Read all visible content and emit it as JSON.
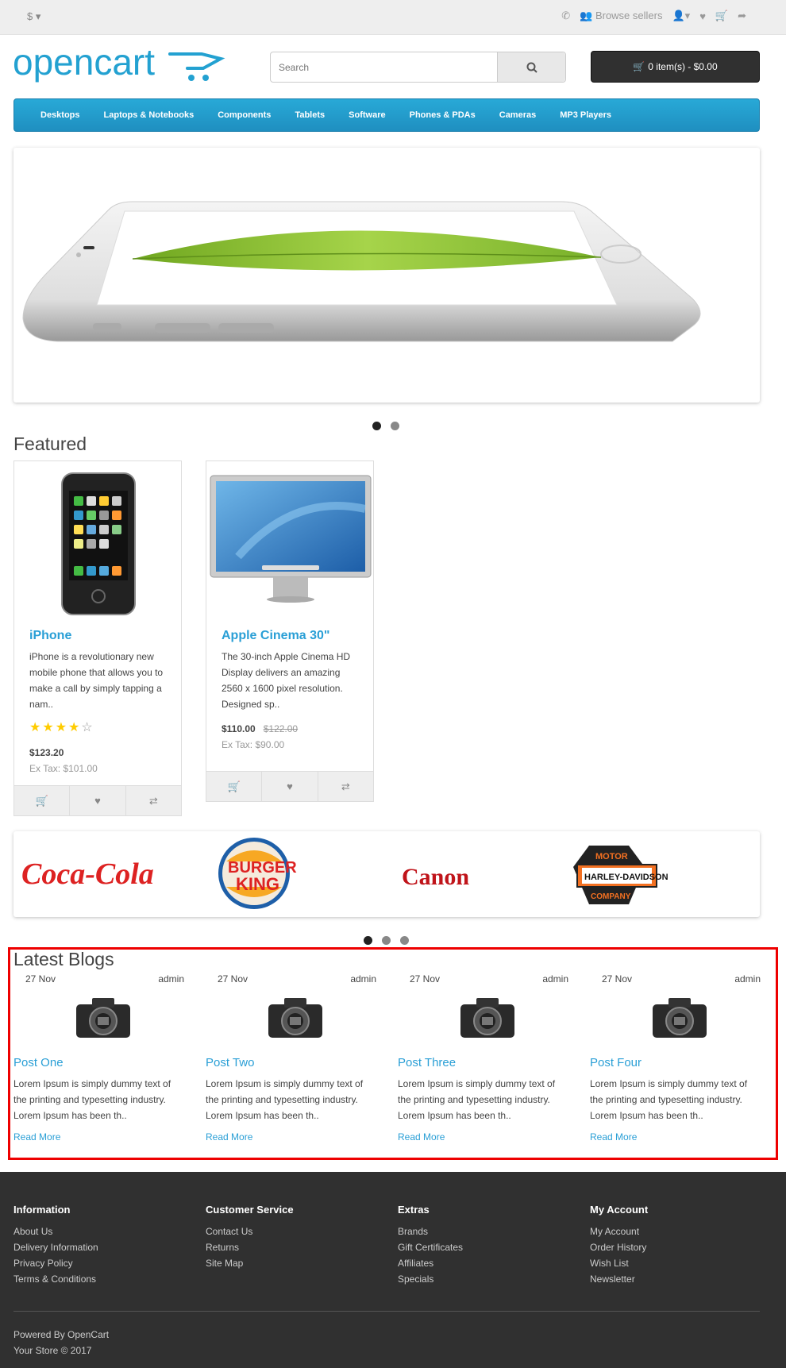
{
  "topbar": {
    "currency": "$",
    "browse_sellers": "Browse sellers"
  },
  "logo": {
    "text": "opencart"
  },
  "search": {
    "placeholder": "Search"
  },
  "cart": {
    "label": "0 item(s) - $0.00"
  },
  "nav": {
    "items": [
      "Desktops",
      "Laptops & Notebooks",
      "Components",
      "Tablets",
      "Software",
      "Phones & PDAs",
      "Cameras",
      "MP3 Players"
    ]
  },
  "featured": {
    "title": "Featured",
    "products": [
      {
        "name": "iPhone",
        "desc": "iPhone is a revolutionary new mobile phone that allows you to make a call by simply tapping a nam..",
        "rating": 4,
        "price": "$123.20",
        "old_price": "",
        "tax": "Ex Tax: $101.00"
      },
      {
        "name": "Apple Cinema 30\"",
        "desc": "The 30-inch Apple Cinema HD Display delivers an amazing 2560 x 1600 pixel resolution. Designed sp..",
        "rating": 0,
        "price": "$110.00",
        "old_price": "$122.00",
        "tax": "Ex Tax: $90.00"
      }
    ]
  },
  "brands": {
    "items": [
      "Coca-Cola",
      "Burger King",
      "Canon",
      "Harley-Davidson"
    ],
    "canon_text": "Canon"
  },
  "blogs": {
    "title": "Latest Blogs",
    "posts": [
      {
        "date": "27 Nov",
        "author": "admin",
        "title": "Post One",
        "desc": "Lorem Ipsum is simply dummy text of the printing and typesetting industry. Lorem Ipsum has been th..",
        "more": "Read More"
      },
      {
        "date": "27 Nov",
        "author": "admin",
        "title": "Post Two",
        "desc": "Lorem Ipsum is simply dummy text of the printing and typesetting industry. Lorem Ipsum has been th..",
        "more": "Read More"
      },
      {
        "date": "27 Nov",
        "author": "admin",
        "title": "Post Three",
        "desc": "Lorem Ipsum is simply dummy text of the printing and typesetting industry. Lorem Ipsum has been th..",
        "more": "Read More"
      },
      {
        "date": "27 Nov",
        "author": "admin",
        "title": "Post Four",
        "desc": "Lorem Ipsum is simply dummy text of the printing and typesetting industry. Lorem Ipsum has been th..",
        "more": "Read More"
      }
    ]
  },
  "footer": {
    "columns": [
      {
        "title": "Information",
        "links": [
          "About Us",
          "Delivery Information",
          "Privacy Policy",
          "Terms & Conditions"
        ]
      },
      {
        "title": "Customer Service",
        "links": [
          "Contact Us",
          "Returns",
          "Site Map"
        ]
      },
      {
        "title": "Extras",
        "links": [
          "Brands",
          "Gift Certificates",
          "Affiliates",
          "Specials"
        ]
      },
      {
        "title": "My Account",
        "links": [
          "My Account",
          "Order History",
          "Wish List",
          "Newsletter"
        ]
      }
    ],
    "powered_prefix": "Powered By",
    "powered_link": "OpenCart",
    "copyright": "Your Store © 2017"
  },
  "colors": {
    "accent": "#2a9fd6",
    "nav": "#229ccb",
    "footer": "#303030",
    "highlight": "#e00000"
  }
}
